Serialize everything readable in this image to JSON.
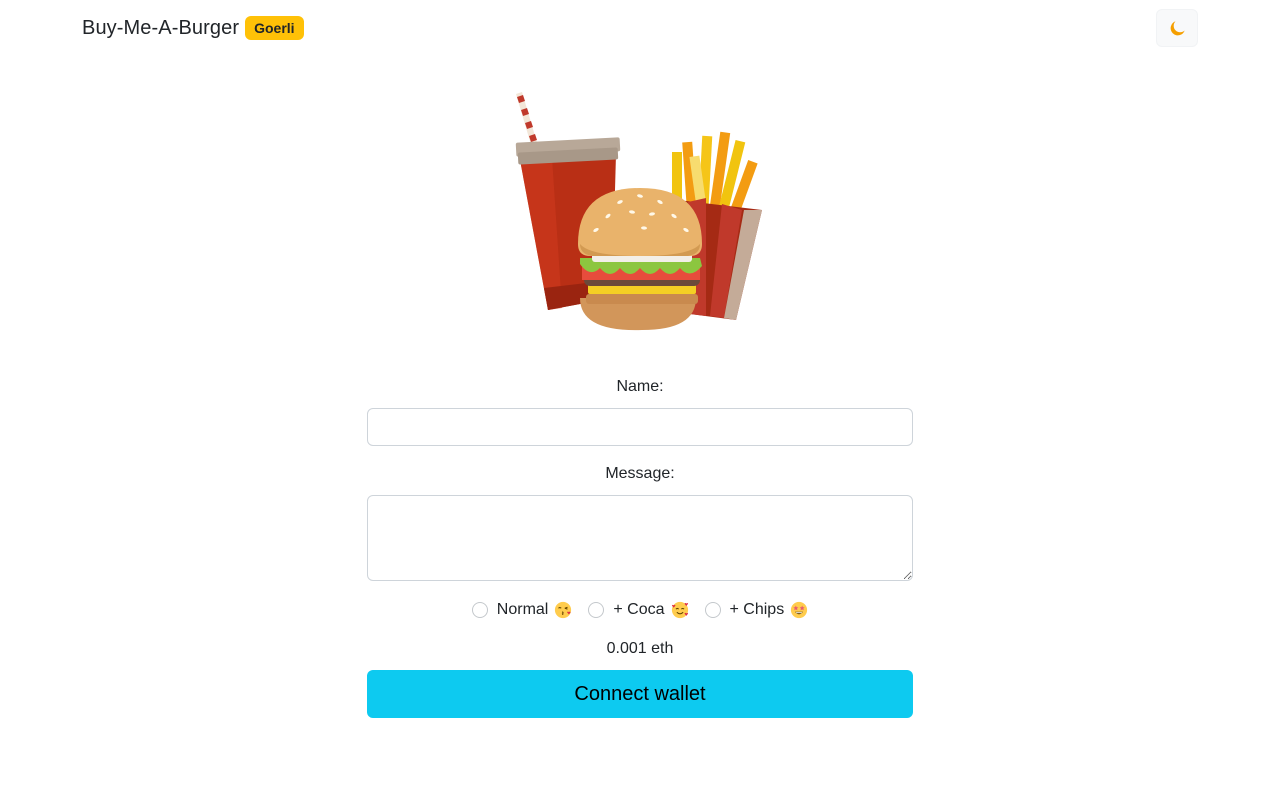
{
  "header": {
    "brand": "Buy-Me-A-Burger",
    "network_badge": "Goerli",
    "theme_toggle_icon": "moon-icon",
    "accent_color": "#ffc107"
  },
  "hero": {
    "illustration": "burger-combo-illustration"
  },
  "form": {
    "name_label": "Name:",
    "name_value": "",
    "message_label": "Message:",
    "message_value": "",
    "options": [
      {
        "label": "Normal",
        "emoji_icon": "kissing-face-icon",
        "selected": false
      },
      {
        "label": "+ Coca",
        "emoji_icon": "smiling-face-with-hearts-icon",
        "selected": false
      },
      {
        "label": "+ Chips",
        "emoji_icon": "star-struck-icon",
        "selected": false
      }
    ],
    "price": "0.001 eth",
    "connect_button": "Connect wallet",
    "button_color": "#0dcaf0"
  }
}
